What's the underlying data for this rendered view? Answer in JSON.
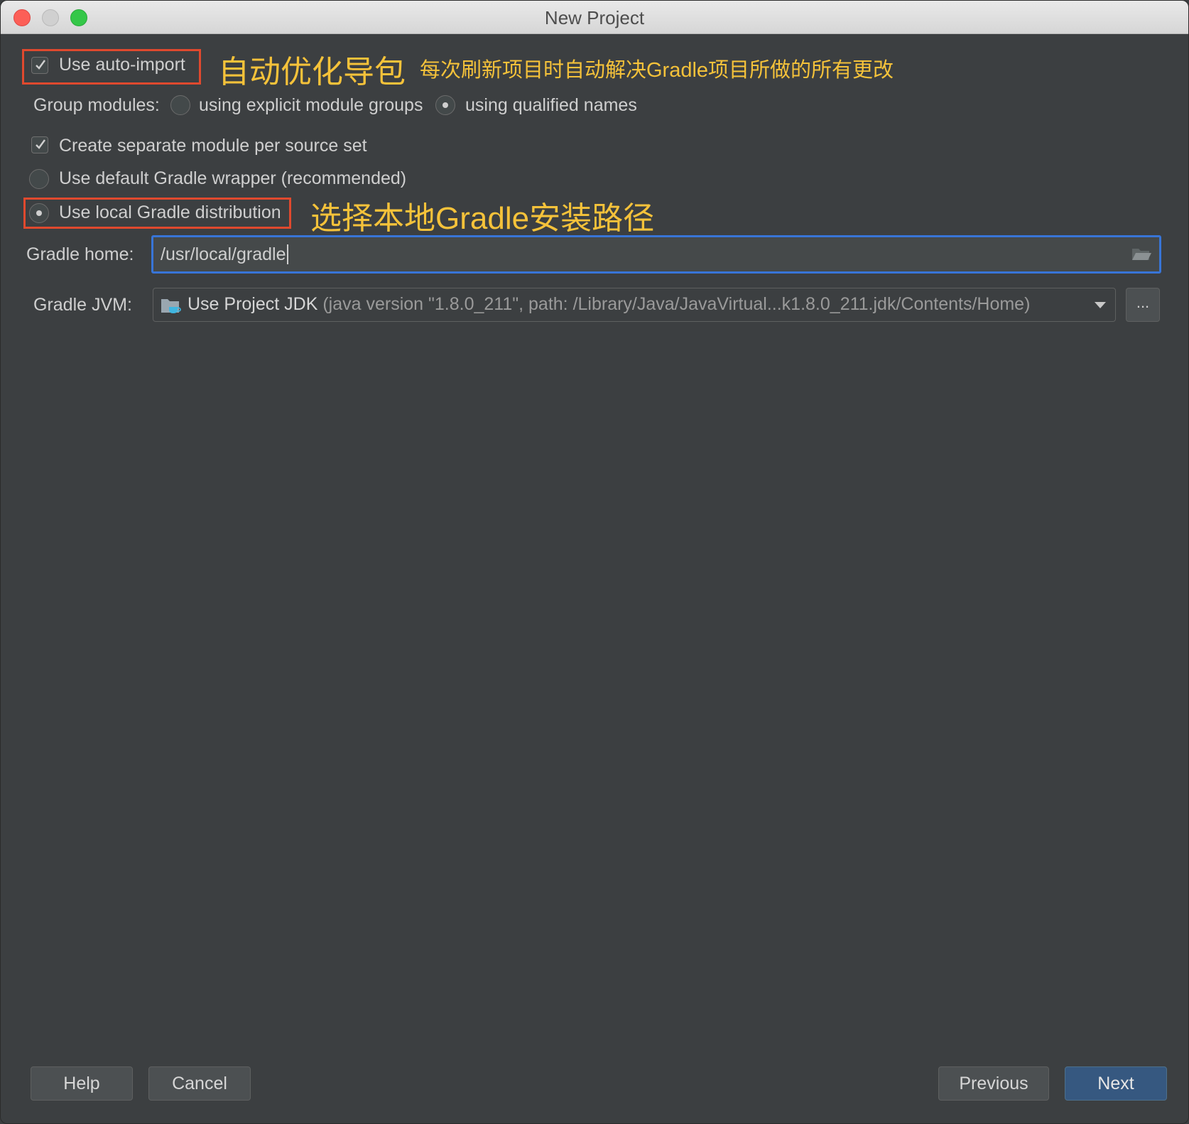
{
  "window": {
    "title": "New Project"
  },
  "options": {
    "auto_import": {
      "label": "Use auto-import",
      "checked": true
    },
    "group_modules": {
      "label": "Group modules:",
      "options": [
        {
          "label": "using explicit module groups",
          "selected": false
        },
        {
          "label": "using qualified names",
          "selected": true
        }
      ]
    },
    "separate_module": {
      "label": "Create separate module per source set",
      "checked": true
    },
    "gradle_wrapper": {
      "label": "Use default Gradle wrapper (recommended)",
      "selected": false
    },
    "local_gradle": {
      "label": "Use local Gradle distribution",
      "selected": true
    },
    "gradle_home": {
      "label": "Gradle home:",
      "value": "/usr/local/gradle"
    },
    "gradle_jvm": {
      "label": "Gradle JVM:",
      "selected_name": "Use Project JDK",
      "selected_detail": "(java version \"1.8.0_211\", path: /Library/Java/JavaVirtual...k1.8.0_211.jdk/Contents/Home)",
      "more_label": "..."
    }
  },
  "annotations": {
    "auto_import_title": "自动优化导包",
    "auto_import_desc": "每次刷新项目时自动解决Gradle项目所做的所有更改",
    "local_gradle_note": "选择本地Gradle安装路径"
  },
  "footer": {
    "help": "Help",
    "cancel": "Cancel",
    "previous": "Previous",
    "next": "Next"
  },
  "colors": {
    "background": "#3c3f41",
    "annotation_box": "#e0492e",
    "annotation_text": "#f5c23a",
    "focus_border": "#3875d7",
    "primary_button": "#365880"
  }
}
